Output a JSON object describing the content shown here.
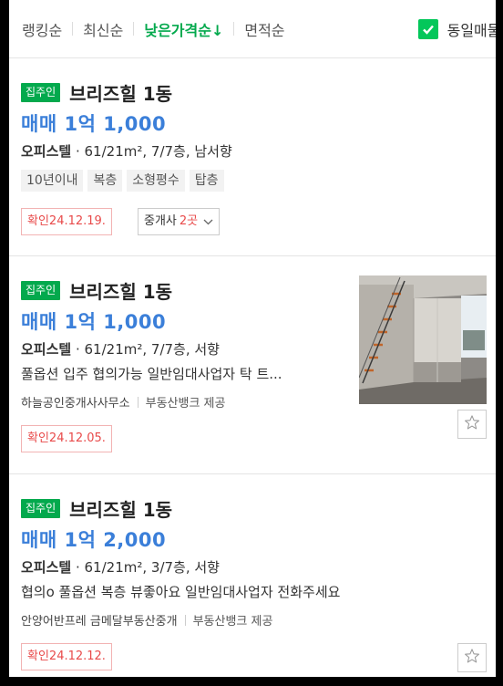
{
  "sort": {
    "options": [
      "랭킹순",
      "최신순",
      "낮은가격순↓",
      "면적순"
    ],
    "active": "낮은가격순↓"
  },
  "group_toggle": {
    "label": "동일매물 묶기",
    "checked": true
  },
  "listings": [
    {
      "badge": "집주인",
      "title": "브리즈힐 1동",
      "price": "매매 1억 1,000",
      "spec_type": "오피스텔",
      "spec_detail": " · 61/21m², 7/7층, 남서향",
      "tags": [
        "10년이내",
        "복층",
        "소형평수",
        "탑층"
      ],
      "confirm": "확인24.12.19.",
      "agent_label": "중개사",
      "agent_count": "2곳"
    },
    {
      "badge": "집주인",
      "title": "브리즈힐 1동",
      "price": "매매 1억 1,000",
      "spec_type": "오피스텔",
      "spec_detail": " · 61/21m², 7/7층, 서향",
      "description": "풀옵션 입주 협의가능 일반임대사업자 탁 트...",
      "agency": "하늘공인중개사사무소",
      "provider": "부동산뱅크 제공",
      "confirm": "확인24.12.05."
    },
    {
      "badge": "집주인",
      "title": "브리즈힐 1동",
      "price": "매매 1억 2,000",
      "spec_type": "오피스텔",
      "spec_detail": " · 61/21m², 3/7층, 서향",
      "description": "협의o 풀옵션 복층 뷰좋아요 일반임대사업자 전화주세요",
      "agency": "안양어반프레 금메달부동산중개",
      "provider": "부동산뱅크 제공",
      "confirm": "확인24.12.12."
    }
  ],
  "icons": {
    "checkbox": "check-icon",
    "agent_dropdown": "chevron-down-icon",
    "favorite": "star-outline-icon"
  },
  "colors": {
    "accent_green": "#03c75a",
    "price_blue": "#3b7fd9",
    "confirm_red": "#e84a4a"
  }
}
